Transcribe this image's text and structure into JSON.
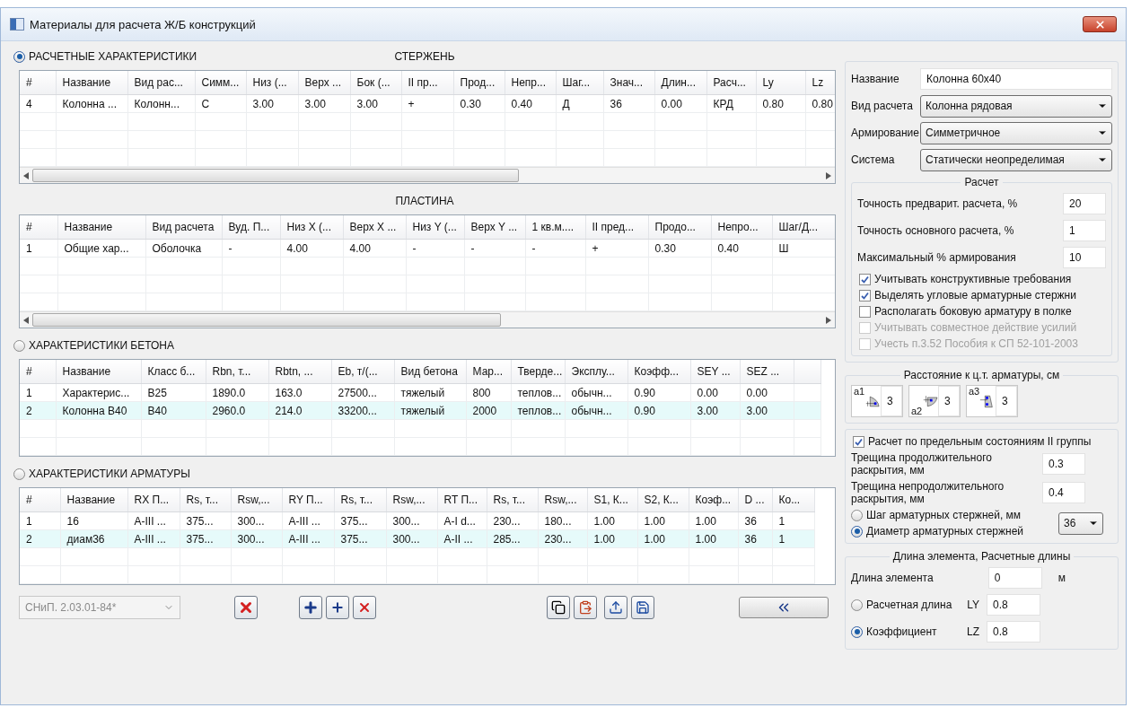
{
  "window": {
    "title": "Материалы для расчета Ж/Б конструкций"
  },
  "rod": {
    "radio_label": "РАСЧЕТНЫЕ ХАРАКТЕРИСТИКИ",
    "selected": true,
    "title": "СТЕРЖЕНЬ",
    "columns": [
      "#",
      "Название",
      "Вид рас...",
      "Симм...",
      "Низ (...",
      "Верх ...",
      "Бок (...",
      "II пр...",
      "Прод...",
      "Непр...",
      "Шаг...",
      "Знач...",
      "Длин...",
      "Расч...",
      "Ly",
      "Lz"
    ],
    "rows": [
      {
        "selected": false,
        "cells": [
          "4",
          "Колонна ...",
          "Колонн...",
          "С",
          "3.00",
          "3.00",
          "3.00",
          "+",
          "0.30",
          "0.40",
          "Д",
          "36",
          "0.00",
          "КРД",
          "0.80",
          "0.80"
        ]
      }
    ]
  },
  "plate": {
    "title": "ПЛАСТИНА",
    "columns": [
      "#",
      "Название",
      "Вид расчета",
      "Вуд. П...",
      "Низ X (...",
      "Верх X ...",
      "Низ Y (...",
      "Верх Y ...",
      "1 кв.м....",
      "II пред...",
      "Продо...",
      "Непро...",
      "Шаг/Д..."
    ],
    "rows": [
      {
        "selected": false,
        "cells": [
          "1",
          "Общие хар...",
          "Оболочка",
          "-",
          "4.00",
          "4.00",
          "-",
          "-",
          "-",
          "+",
          "0.30",
          "0.40",
          "Ш"
        ]
      }
    ]
  },
  "concrete": {
    "radio_label": "ХАРАКТЕРИСТИКИ БЕТОНА",
    "selected": false,
    "columns": [
      "#",
      "Название",
      "Класс б...",
      "Rbn, т...",
      "Rbtn, ...",
      "Eb, т/(...",
      "Вид бетона",
      "Мар...",
      "Тверде...",
      "Эксплу...",
      "Коэфф...",
      "SEY ...",
      "SEZ ..."
    ],
    "rows": [
      {
        "selected": false,
        "cells": [
          "1",
          "Характерис...",
          "B25",
          "1890.0",
          "163.0",
          "27500...",
          "тяжелый",
          "800",
          "теплов...",
          "обычн...",
          "0.90",
          "0.00",
          "0.00"
        ]
      },
      {
        "selected": true,
        "cells": [
          "2",
          "Колонна В40",
          "B40",
          "2960.0",
          "214.0",
          "33200...",
          "тяжелый",
          "2000",
          "теплов...",
          "обычн...",
          "0.90",
          "3.00",
          "3.00"
        ]
      }
    ]
  },
  "rebar": {
    "radio_label": "ХАРАКТЕРИСТИКИ АРМАТУРЫ",
    "selected": false,
    "columns": [
      "#",
      "Название",
      "RX П...",
      "Rs, т...",
      "Rsw,...",
      "RY П...",
      "Rs, т...",
      "Rsw,...",
      "RT П...",
      "Rs, т...",
      "Rsw,...",
      "S1, К...",
      "S2, К...",
      "Коэф...",
      "D ...",
      "Ко..."
    ],
    "rows": [
      {
        "selected": false,
        "cells": [
          "1",
          "16",
          "A-III ...",
          "375...",
          "300...",
          "A-III ...",
          "375...",
          "300...",
          "A-I d...",
          "230...",
          "180...",
          "1.00",
          "1.00",
          "1.00",
          "36",
          "1"
        ]
      },
      {
        "selected": true,
        "cells": [
          "2",
          "диам36",
          "A-III ...",
          "375...",
          "300...",
          "A-III ...",
          "375...",
          "300...",
          "A-II ...",
          "285...",
          "230...",
          "1.00",
          "1.00",
          "1.00",
          "36",
          "1"
        ]
      }
    ]
  },
  "norm_select": {
    "value": "СНиП. 2.03.01-84*",
    "disabled": true
  },
  "side": {
    "fields": [
      {
        "kind": "input",
        "label": "Название",
        "value": "Колонна 60x40"
      },
      {
        "kind": "select",
        "label": "Вид расчета",
        "value": "Колонна рядовая"
      },
      {
        "kind": "select",
        "label": "Армирование",
        "value": "Симметричное"
      },
      {
        "kind": "select",
        "label": "Система",
        "value": "Статически неопределимая"
      }
    ],
    "calc": {
      "title": "Расчет",
      "inputs": [
        {
          "label": "Точность предварит. расчета, %",
          "value": "20"
        },
        {
          "label": "Точность основного расчета, %",
          "value": "1"
        },
        {
          "label": "Максимальный % армирования",
          "value": "10"
        }
      ],
      "checks": [
        {
          "label": "Учитывать конструктивные требования",
          "checked": true,
          "disabled": false
        },
        {
          "label": "Выделять угловые арматурные стержни",
          "checked": true,
          "disabled": false
        },
        {
          "label": "Располагать боковую арматуру в полке",
          "checked": false,
          "disabled": false
        },
        {
          "label": "Учитывать совместное действие усилий",
          "checked": false,
          "disabled": true
        },
        {
          "label": "Учесть п.3.52 Пособия к СП 52-101-2003",
          "checked": false,
          "disabled": true
        }
      ]
    },
    "cover": {
      "title": "Расстояние к ц.т. арматуры, см",
      "items": [
        {
          "mark": "a1",
          "value": "3"
        },
        {
          "mark": "a2",
          "value": "3"
        },
        {
          "mark": "a3",
          "value": "3"
        }
      ]
    },
    "cracks": {
      "check_label": "Расчет по предельным состояниям II группы",
      "checked": true,
      "inputs": [
        {
          "label": "Трещина продолжительного раскрытия, мм",
          "value": "0.3"
        },
        {
          "label": "Трещина непродолжительного раскрытия, мм",
          "value": "0.4"
        }
      ],
      "radios": [
        {
          "label": "Шаг арматурных стержней, мм",
          "selected": false
        },
        {
          "label": "Диаметр арматурных стержней",
          "selected": true
        }
      ],
      "select": "36"
    },
    "length": {
      "title": "Длина элемента, Расчетные длины",
      "label": "Длина элемента",
      "value": "0",
      "unit": "м",
      "radios": [
        {
          "label": "Расчетная длина",
          "selected": false,
          "axis": "LY",
          "value": "0.8"
        },
        {
          "label": "Коэффициент",
          "selected": true,
          "axis": "LZ",
          "value": "0.8"
        }
      ]
    }
  }
}
